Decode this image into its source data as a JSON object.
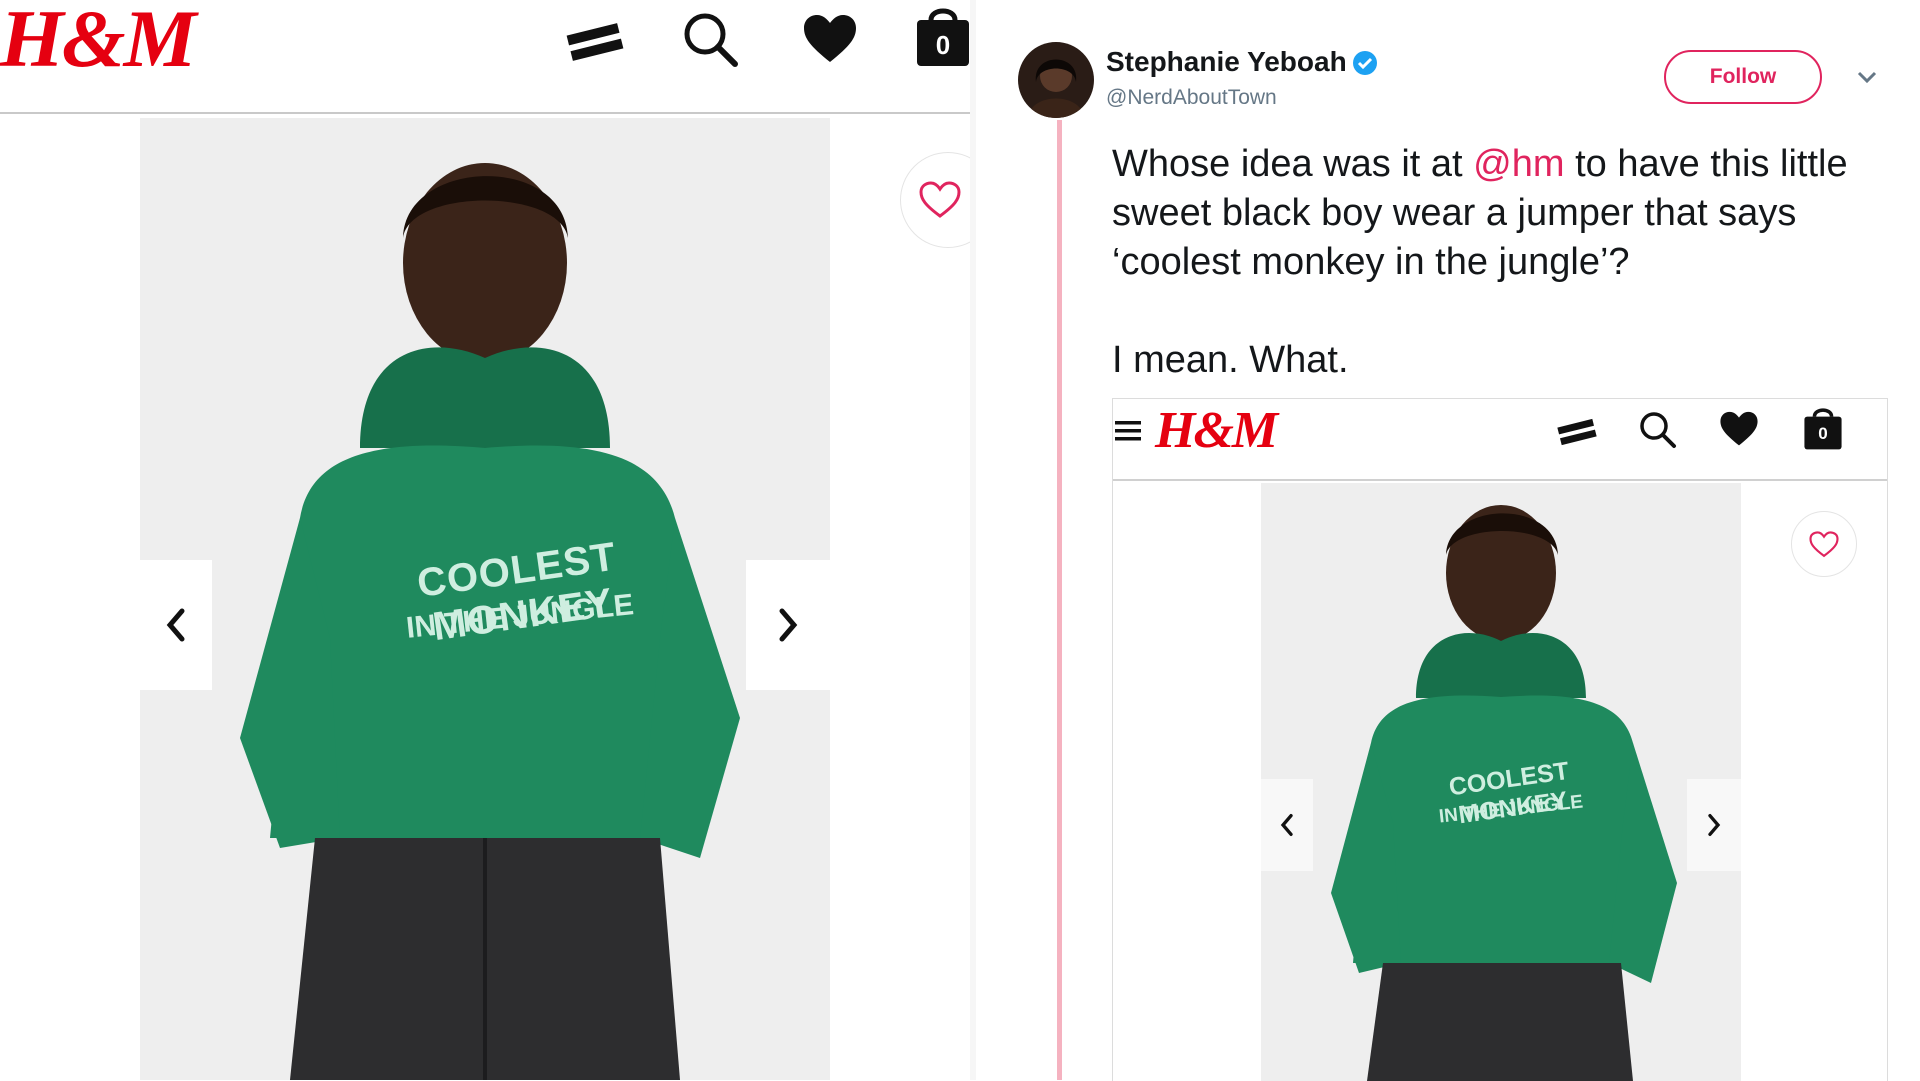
{
  "left_panel": {
    "brand_logo": "H&M",
    "bag_count": "0",
    "shirt_text_line1": "COOLEST MONKEY",
    "shirt_text_line2": "IN THE JUNGLE"
  },
  "tweet": {
    "author_name": "Stephanie Yeboah",
    "author_handle": "@NerdAboutTown",
    "follow_label": "Follow",
    "text_before_mention": "Whose idea was it at ",
    "mention": "@hm",
    "text_after_mention": " to have this little sweet black boy wear a jumper that says ‘coolest monkey in the jungle’?",
    "second_paragraph": "I mean. What."
  },
  "embedded_screenshot": {
    "brand_logo": "H&M",
    "bag_count": "0",
    "shirt_text_line1": "COOLEST MONKEY",
    "shirt_text_line2": "IN THE JUNGLE"
  },
  "colors": {
    "brand_red": "#e50010",
    "twitter_pink": "#e0245e",
    "verified_blue": "#1da1f2",
    "hoodie_green": "#1f8a5e"
  }
}
